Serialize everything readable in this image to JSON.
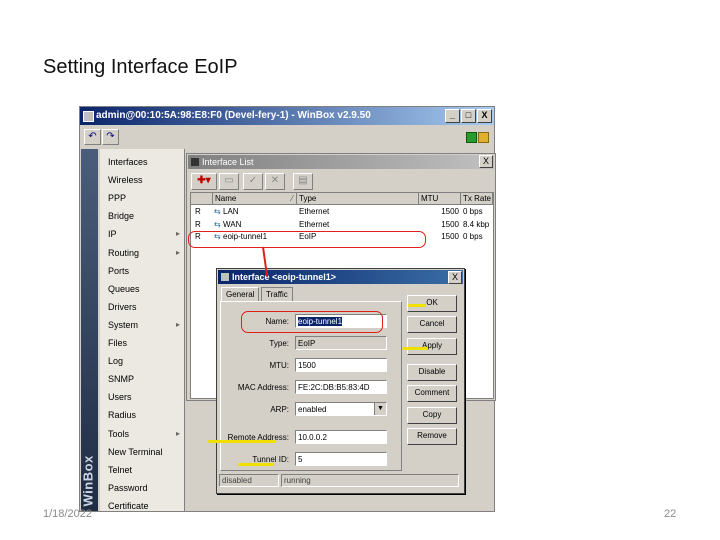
{
  "slide": {
    "title": "Setting Interface EoIP",
    "date": "1/18/2022",
    "page": "22"
  },
  "winbox": {
    "title": "admin@00:10:5A:98:E8:F0 (Devel-fery-1) - WinBox v2.9.50",
    "controls": [
      "_",
      "□",
      "X"
    ],
    "side_label": "WinBox",
    "menu": [
      "Interfaces",
      "Wireless",
      "PPP",
      "Bridge",
      "IP",
      "Routing",
      "Ports",
      "Queues",
      "Drivers",
      "System",
      "Files",
      "Log",
      "SNMP",
      "Users",
      "Radius",
      "Tools",
      "New Terminal",
      "Telnet",
      "Password",
      "Certificate"
    ],
    "menu_submenu_markers": [
      "IP",
      "Routing",
      "System",
      "Tools"
    ]
  },
  "interface_list": {
    "title": "Interface List",
    "close": "X",
    "columns": [
      "Name",
      "Type",
      "MTU",
      "Tx Rate"
    ],
    "rows": [
      {
        "flag": "R",
        "name": "LAN",
        "type": "Ethernet",
        "mtu": "1500",
        "tx": "0 bps"
      },
      {
        "flag": "R",
        "name": "WAN",
        "type": "Ethernet",
        "mtu": "1500",
        "tx": "8.4 kbp"
      },
      {
        "flag": "R",
        "name": "eoip-tunnel1",
        "type": "EoIP",
        "mtu": "1500",
        "tx": "0 bps"
      }
    ]
  },
  "dialog": {
    "title": "Interface <eoip-tunnel1>",
    "close": "X",
    "tabs": [
      "General",
      "Traffic"
    ],
    "labels": {
      "name": "Name:",
      "type": "Type:",
      "mtu": "MTU:",
      "mac": "MAC Address:",
      "arp": "ARP:",
      "remote": "Remote Address:",
      "tunnel": "Tunnel ID:"
    },
    "values": {
      "name": "eoip-tunnel1",
      "type": "EoIP",
      "mtu": "1500",
      "mac": "FE:2C:DB:B5:83:4D",
      "arp": "enabled",
      "remote": "10.0.0.2",
      "tunnel": "5"
    },
    "buttons": [
      "OK",
      "Cancel",
      "Apply",
      "Disable",
      "Comment",
      "Copy",
      "Remove"
    ],
    "status": [
      "disabled",
      "running"
    ]
  },
  "colors": {
    "annotation": "#e0201a",
    "highlight": "#f0e000",
    "titlebar": "#0a246a"
  }
}
